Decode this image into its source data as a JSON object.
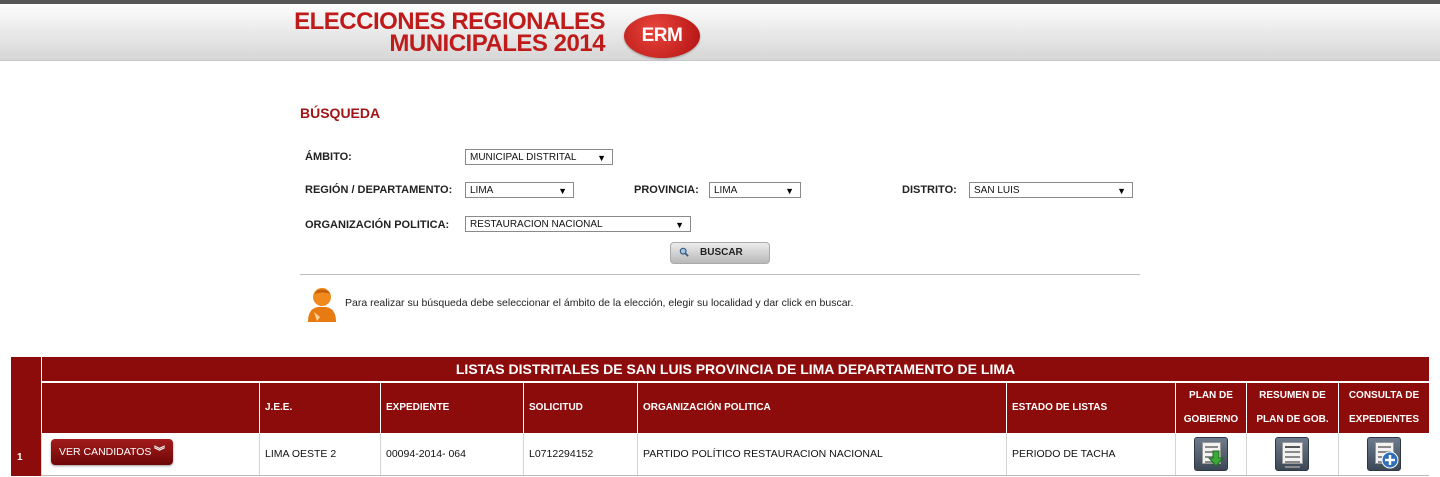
{
  "header": {
    "title_line1": "ELECCIONES REGIONALES",
    "title_line2": "MUNICIPALES 2014",
    "badge": "ERM"
  },
  "search": {
    "title": "BÚSQUEDA",
    "ambito_label": "ÁMBITO:",
    "ambito_value": "MUNICIPAL DISTRITAL",
    "region_label": "REGIÓN / DEPARTAMENTO:",
    "region_value": "LIMA",
    "provincia_label": "PROVINCIA:",
    "provincia_value": "LIMA",
    "distrito_label": "DISTRITO:",
    "distrito_value": "SAN LUIS",
    "org_label": "ORGANIZACIÓN POLITICA:",
    "org_value": "RESTAURACION NACIONAL",
    "button": "BUSCAR",
    "info": "Para realizar su búsqueda debe seleccionar el ámbito de la elección, elegir su localidad y dar click en buscar."
  },
  "table": {
    "title": "LISTAS DISTRITALES DE SAN LUIS PROVINCIA DE LIMA DEPARTAMENTO DE LIMA",
    "headers": {
      "jee": "J.E.E.",
      "expediente": "EXPEDIENTE",
      "solicitud": "SOLICITUD",
      "organizacion": "ORGANIZACIÓN POLITICA",
      "estado": "ESTADO DE LISTAS",
      "plan_l1": "PLAN DE",
      "plan_l2": "GOBIERNO",
      "resumen_l1": "RESUMEN DE",
      "resumen_l2": "PLAN DE GOB.",
      "consulta_l1": "CONSULTA DE",
      "consulta_l2": "EXPEDIENTES"
    },
    "rows": [
      {
        "num": "1",
        "button": "VER CANDIDATOS",
        "jee": "LIMA OESTE 2",
        "expediente": "00094-2014- 064",
        "solicitud": "L0712294152",
        "organizacion": "PARTIDO POLÍTICO RESTAURACION NACIONAL",
        "estado": "PERIODO DE TACHA"
      }
    ]
  },
  "colors": {
    "brand_red": "#c01b1b",
    "table_header": "#8c0b0b"
  },
  "icons": [
    "chevron-down-icon",
    "search-icon",
    "info-person-icon",
    "download-doc-icon",
    "summary-doc-icon",
    "consult-doc-icon"
  ]
}
